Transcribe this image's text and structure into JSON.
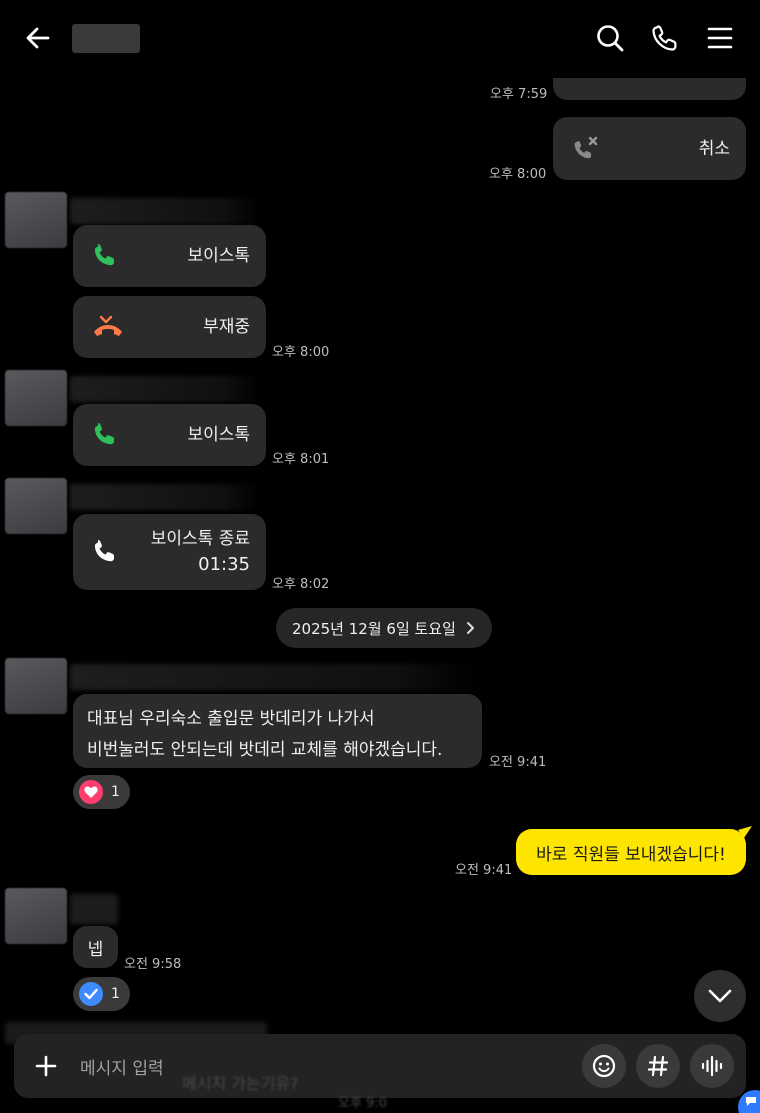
{
  "header": {
    "back_icon": "arrow-left-icon",
    "search_icon": "search-icon",
    "call_icon": "phone-icon",
    "menu_icon": "menu-icon"
  },
  "messages": {
    "m1_time": "오후 7:59",
    "m2_label": "취소",
    "m2_time": "오후 8:00",
    "m3_label": "보이스톡",
    "m4_label": "부재중",
    "m4_time": "오후 8:00",
    "m5_label": "보이스톡",
    "m5_time": "오후 8:01",
    "m6_line1": "보이스톡 종료",
    "m6_line2": "01:35",
    "m6_time": "오후 8:02",
    "date_divider": "2025년 12월 6일 토요일",
    "m7_line1": "대표님 우리숙소 출입문 밧데리가 나가서",
    "m7_line2": "비번눌러도 안되는데 밧데리 교체를 해야겠습니다.",
    "m7_time": "오전 9:41",
    "m7_reaction_count": "1",
    "m8_text": "바로 직원들 보내겠습니다!",
    "m8_time": "오전 9:41",
    "m9_text": "넵",
    "m9_time": "오전 9:58",
    "m9_reaction_count": "1"
  },
  "composer": {
    "placeholder": "메시지 입력",
    "behind_text": "메시지 가는기유?",
    "behind_time": "오후 9:0"
  },
  "colors": {
    "accent_yellow": "#fee500",
    "call_green": "#2ec05a",
    "missed_orange": "#ff7a45",
    "heart_pink": "#ff3d6e",
    "check_blue": "#3d8bff"
  }
}
